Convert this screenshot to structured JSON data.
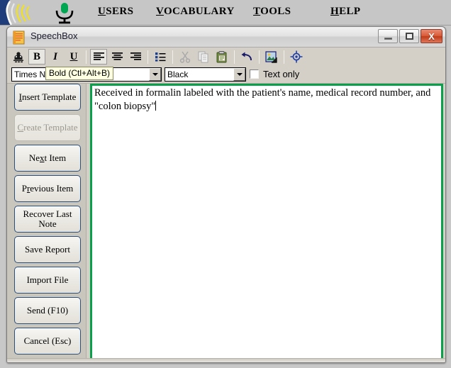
{
  "appbar": {
    "icons": {
      "speaker": "speaker-waves-icon",
      "mic": "microphone-icon"
    },
    "menu": [
      {
        "name": "users",
        "mnemonic": "U",
        "rest": "SERS"
      },
      {
        "name": "vocabulary",
        "mnemonic": "V",
        "rest": "OCABULARY"
      },
      {
        "name": "tools",
        "mnemonic": "T",
        "rest": "OOLS"
      },
      {
        "name": "help",
        "mnemonic": "H",
        "rest": "ELP"
      }
    ]
  },
  "window": {
    "title": "SpeechBox",
    "app_icon": "notepad-icon",
    "controls": {
      "minimize": "Minimize",
      "maximize": "Maximize",
      "close": "X"
    }
  },
  "toolbar": {
    "buttons": [
      {
        "name": "spell-check-icon",
        "label": "",
        "style": "icon",
        "state": "normal"
      },
      {
        "name": "bold-button",
        "label": "B",
        "style": "bold",
        "state": "framed"
      },
      {
        "name": "italic-button",
        "label": "I",
        "style": "ital",
        "state": "normal"
      },
      {
        "name": "underline-button",
        "label": "U",
        "style": "und",
        "state": "normal"
      },
      {
        "name": "align-left-button",
        "label": "",
        "style": "icon",
        "state": "framed"
      },
      {
        "name": "align-center-button",
        "label": "",
        "style": "icon",
        "state": "normal"
      },
      {
        "name": "align-right-button",
        "label": "",
        "style": "icon",
        "state": "normal"
      },
      {
        "name": "bullet-list-button",
        "label": "",
        "style": "icon",
        "state": "normal"
      },
      {
        "name": "cut-button",
        "label": "",
        "style": "icon",
        "state": "disabled"
      },
      {
        "name": "copy-button",
        "label": "",
        "style": "icon",
        "state": "disabled"
      },
      {
        "name": "paste-button",
        "label": "",
        "style": "icon",
        "state": "normal"
      },
      {
        "name": "undo-button",
        "label": "",
        "style": "icon",
        "state": "normal"
      },
      {
        "name": "insert-image-button",
        "label": "",
        "style": "icon",
        "state": "normal"
      },
      {
        "name": "target-button",
        "label": "",
        "style": "icon",
        "state": "normal"
      }
    ],
    "tooltip": "Bold (Ctl+Alt+B)",
    "font_value": "Times Ne",
    "color_value": "Black",
    "text_only_label": "Text only",
    "text_only_checked": false
  },
  "sidebar": {
    "buttons": [
      {
        "name": "insert-template",
        "pre": "",
        "mnemonic": "I",
        "post": "nsert Template",
        "line2": "",
        "disabled": false
      },
      {
        "name": "create-template",
        "pre": "",
        "mnemonic": "C",
        "post": "reate Template",
        "line2": "",
        "disabled": true
      },
      {
        "name": "next-item",
        "pre": "Ne",
        "mnemonic": "x",
        "post": "t Item",
        "line2": "",
        "disabled": false
      },
      {
        "name": "previous-item",
        "pre": "P",
        "mnemonic": "r",
        "post": "evious Item",
        "line2": "",
        "disabled": false
      },
      {
        "name": "recover-last-note",
        "pre": "Recover Last",
        "mnemonic": "",
        "post": "",
        "line2": "Note",
        "disabled": false
      },
      {
        "name": "save-report",
        "pre": "Save Report",
        "mnemonic": "",
        "post": "",
        "line2": "",
        "disabled": false
      },
      {
        "name": "import-file",
        "pre": "Import File",
        "mnemonic": "",
        "post": "",
        "line2": "",
        "disabled": false
      },
      {
        "name": "send-f10",
        "pre": "Send (F10)",
        "mnemonic": "",
        "post": "",
        "line2": "",
        "disabled": false
      },
      {
        "name": "cancel-esc",
        "pre": "Cancel (Esc)",
        "mnemonic": "",
        "post": "",
        "line2": "",
        "disabled": false
      }
    ]
  },
  "editor": {
    "content": "Received in formalin labeled with the patient's name, medical record number, and \"colon biopsy\"",
    "border_color": "#08a04b"
  }
}
